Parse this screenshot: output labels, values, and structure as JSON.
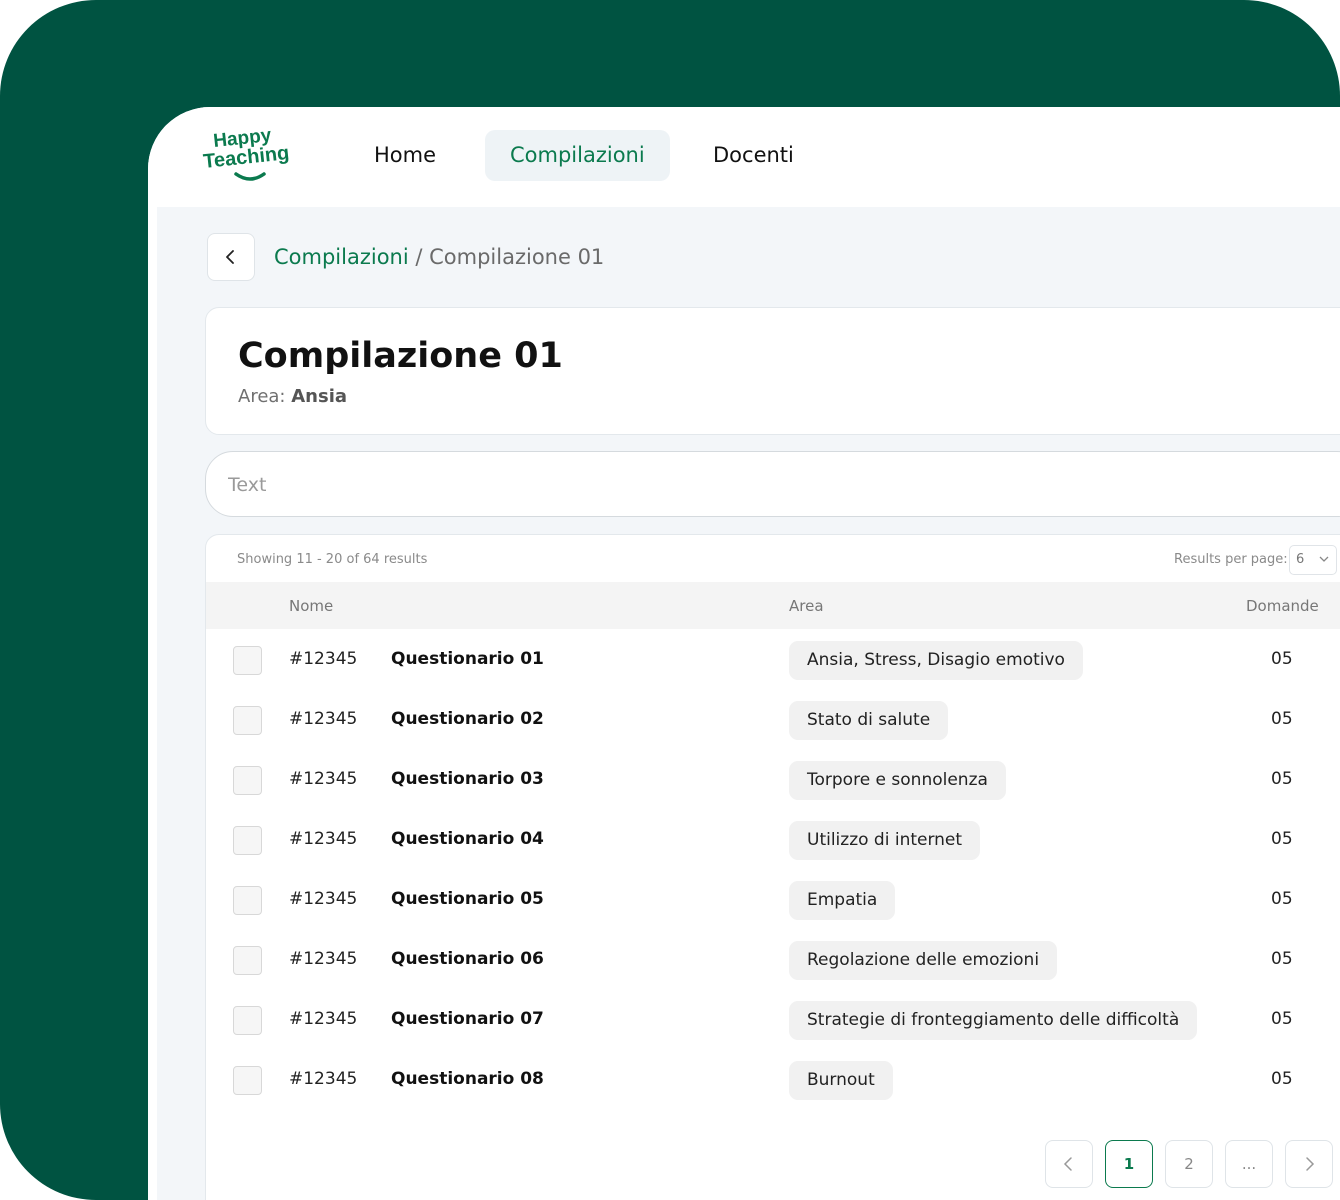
{
  "brand": {
    "line1": "Happy",
    "line2": "Teaching",
    "color": "#0b7a4e",
    "frame_color": "#005341"
  },
  "nav": {
    "items": [
      {
        "label": "Home",
        "active": false
      },
      {
        "label": "Compilazioni",
        "active": true
      },
      {
        "label": "Docenti",
        "active": false
      }
    ]
  },
  "breadcrumb": {
    "back_icon": "chevron-left-icon",
    "link": "Compilazioni",
    "separator": " / ",
    "current": "Compilazione 01"
  },
  "header": {
    "title": "Compilazione 01",
    "area_label": "Area:",
    "area_value": "Ansia"
  },
  "search": {
    "placeholder": "Text",
    "value": ""
  },
  "table": {
    "showing": "Showing 11 - 20 of 64 results",
    "results_per_page_label": "Results per page:",
    "results_per_page_value": "6",
    "columns": [
      "Nome",
      "Area",
      "Domande"
    ],
    "rows": [
      {
        "code": "#12345",
        "name": "Questionario 01",
        "area": "Ansia, Stress, Disagio emotivo",
        "count": "05",
        "checked": false
      },
      {
        "code": "#12345",
        "name": "Questionario 02",
        "area": "Stato di salute",
        "count": "05",
        "checked": false
      },
      {
        "code": "#12345",
        "name": "Questionario 03",
        "area": "Torpore e sonnolenza",
        "count": "05",
        "checked": false
      },
      {
        "code": "#12345",
        "name": "Questionario 04",
        "area": "Utilizzo di internet",
        "count": "05",
        "checked": false
      },
      {
        "code": "#12345",
        "name": "Questionario 05",
        "area": "Empatia",
        "count": "05",
        "checked": false
      },
      {
        "code": "#12345",
        "name": "Questionario 06",
        "area": "Regolazione delle emozioni",
        "count": "05",
        "checked": false
      },
      {
        "code": "#12345",
        "name": "Questionario 07",
        "area": "Strategie di fronteggiamento delle difficoltà",
        "count": "05",
        "checked": false
      },
      {
        "code": "#12345",
        "name": "Questionario 08",
        "area": "Burnout",
        "count": "05",
        "checked": false
      }
    ]
  },
  "pagination": {
    "prev_icon": "chevron-left-icon",
    "pages": [
      "1",
      "2",
      "..."
    ],
    "current": "1",
    "next_icon": "chevron-right-icon"
  }
}
